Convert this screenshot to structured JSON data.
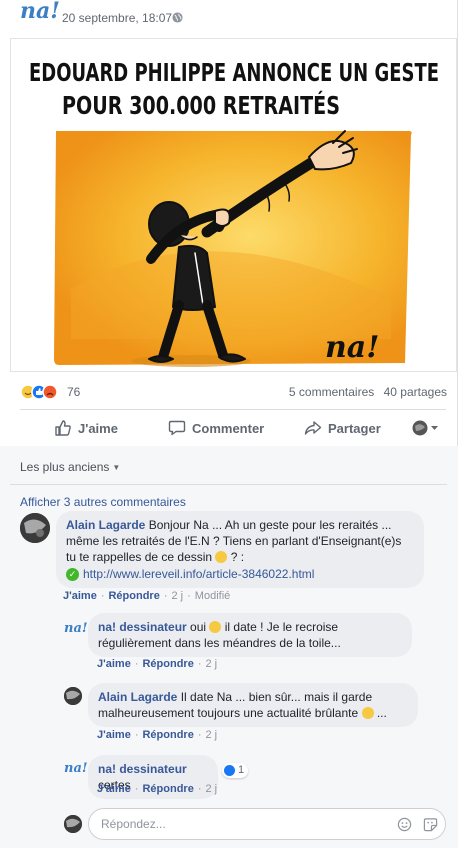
{
  "post": {
    "page_logo": "na!",
    "time": "20 septembre, 18:07",
    "cartoon": {
      "headline_line1": "EDOUARD PHILIPPE ANNONCE UN GESTE",
      "headline_line2": "POUR 300.000 RETRAITÉS",
      "signature": "na!"
    },
    "reaction_count": "76",
    "comments_count": "5 commentaires",
    "shares_count": "40 partages",
    "actions": {
      "like": "J'aime",
      "comment": "Commenter",
      "share": "Partager"
    }
  },
  "comments": {
    "sort_label": "Les plus anciens",
    "more_label": "Afficher 3 autres commentaires",
    "items": [
      {
        "author": "Alain Lagarde",
        "text1": " Bonjour Na ... Ah un geste pour les reraités ... même les retraités de l'E.N ? Tiens en parlant d'Enseignant(e)s tu te rappelles de ce dessin ",
        "text2": " ? :",
        "link": "http://www.lereveil.info/article-3846022.html",
        "like": "J'aime",
        "reply": "Répondre",
        "time": "2 j",
        "edited": "Modifié"
      },
      {
        "author": "na! dessinateur",
        "text1": " oui ",
        "text2": " il date ! Je le recroise régulièrement dans les méandres de la toile...",
        "like": "J'aime",
        "reply": "Répondre",
        "time": "2 j"
      },
      {
        "author": "Alain Lagarde",
        "text1": " Il date Na ... bien sûr... mais il garde malheureusement toujours une actualité brûlante ",
        "text2": " ...",
        "like": "J'aime",
        "reply": "Répondre",
        "time": "2 j"
      },
      {
        "author": "na! dessinateur",
        "text1": " certes",
        "likes": "1",
        "like": "J'aime",
        "reply": "Répondre",
        "time": "2 j"
      }
    ],
    "reply_placeholder": "Répondez..."
  },
  "colors": {
    "link_blue": "#385898",
    "facebook_blue": "#1877f2",
    "cartoon_orange": "#f6a321"
  }
}
